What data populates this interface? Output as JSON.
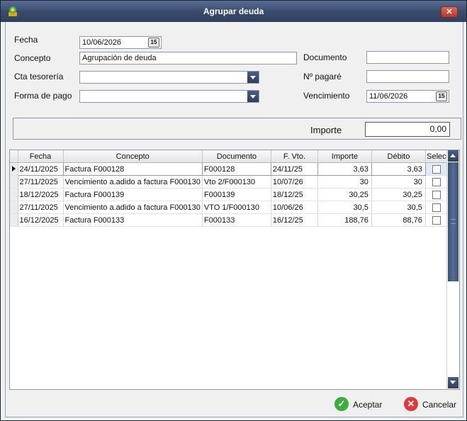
{
  "window": {
    "title": "Agrupar deuda"
  },
  "form": {
    "fecha_label": "Fecha",
    "fecha_value": "10/06/2026",
    "concepto_label": "Concepto",
    "concepto_value": "Agrupación de deuda",
    "cta_label": "Cta tesorería",
    "cta_value": "",
    "forma_label": "Forma de pago",
    "forma_value": "",
    "documento_label": "Documento",
    "documento_value": "",
    "pagare_label": "Nº pagaré",
    "pagare_value": "",
    "venc_label": "Vencimiento",
    "venc_value": "11/06/2026",
    "date_icon": "15"
  },
  "importe": {
    "label": "Importe",
    "value": "0,00"
  },
  "grid": {
    "columns": [
      "Fecha",
      "Concepto",
      "Documento",
      "F. Vto.",
      "Importe",
      "Débito",
      "Selec"
    ],
    "rows": [
      {
        "fecha": "24/11/2025",
        "concepto": "Factura F000128",
        "documento": "F000128",
        "fvto": "24/11/25",
        "importe": "3,63",
        "debito": "3,63",
        "selec": false
      },
      {
        "fecha": "27/11/2025",
        "concepto": "Vencimiento a.adido a factura F000130",
        "documento": "Vto 2/F000130",
        "fvto": "10/07/26",
        "importe": "30",
        "debito": "30",
        "selec": false
      },
      {
        "fecha": "18/12/2025",
        "concepto": "Factura F000139",
        "documento": "F000139",
        "fvto": "18/12/25",
        "importe": "30,25",
        "debito": "30,25",
        "selec": false
      },
      {
        "fecha": "27/11/2025",
        "concepto": "Vencimiento a.adido a factura F000130",
        "documento": "VTO 1/F000130",
        "fvto": "10/06/26",
        "importe": "30,5",
        "debito": "30,5",
        "selec": false
      },
      {
        "fecha": "16/12/2025",
        "concepto": "Factura F000133",
        "documento": "F000133",
        "fvto": "16/12/25",
        "importe": "188,76",
        "debito": "88,76",
        "selec": false
      }
    ]
  },
  "buttons": {
    "aceptar": "Aceptar",
    "cancelar": "Cancelar"
  },
  "colors": {
    "title_bar": "#3a4c6e",
    "accept_green": "#3cae3c",
    "cancel_red": "#e0393a"
  },
  "icons": {
    "accept": "check-icon",
    "cancel": "close-icon",
    "app": "app-icon"
  }
}
